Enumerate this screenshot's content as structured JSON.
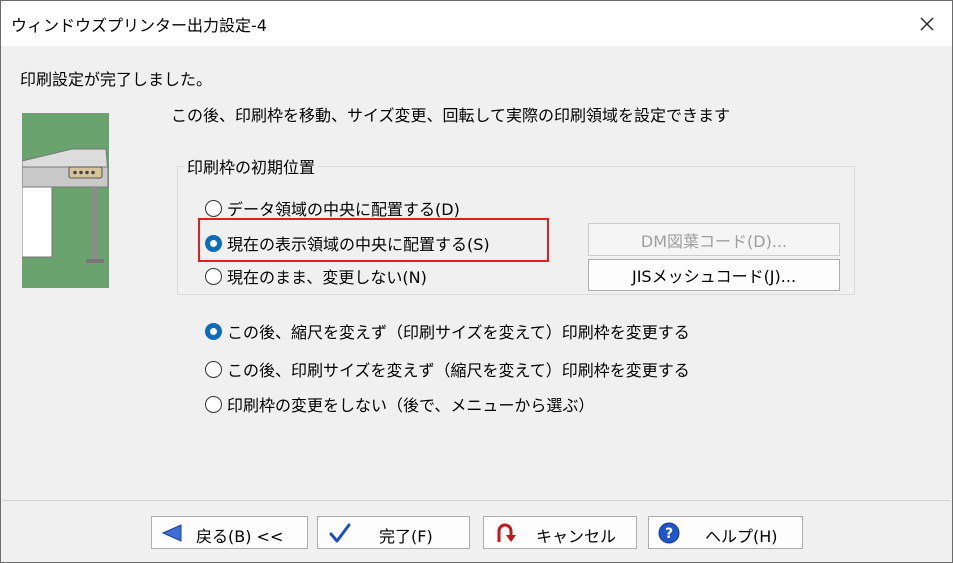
{
  "window": {
    "title": "ウィンドウズプリンター出力設定-4"
  },
  "message": "印刷設定が完了しました。",
  "description": "この後、印刷枠を移動、サイズ変更、回転して実際の印刷領域を設定できます",
  "group": {
    "label": "印刷枠の初期位置",
    "options": [
      {
        "label": "データ領域の中央に配置する(D)",
        "selected": false
      },
      {
        "label": "現在の表示領域の中央に配置する(S)",
        "selected": true
      },
      {
        "label": "現在のまま、変更しない(N)",
        "selected": false
      }
    ],
    "buttons": {
      "dm": "DM図葉コード(D)...",
      "jis": "JISメッシュコード(J)..."
    }
  },
  "mode": {
    "options": [
      {
        "label": "この後、縮尺を変えず（印刷サイズを変えて）印刷枠を変更する",
        "selected": true
      },
      {
        "label": "この後、印刷サイズを変えず（縮尺を変えて）印刷枠を変更する",
        "selected": false
      },
      {
        "label": "印刷枠の変更をしない（後で、メニューから選ぶ）",
        "selected": false
      }
    ]
  },
  "footer": {
    "back": "戻る(B) <<",
    "finish": "完了(F)",
    "cancel": "キャンセル",
    "help": "ヘルプ(H)"
  },
  "colors": {
    "accent": "#0f6cbd",
    "highlight": "#e02020"
  }
}
